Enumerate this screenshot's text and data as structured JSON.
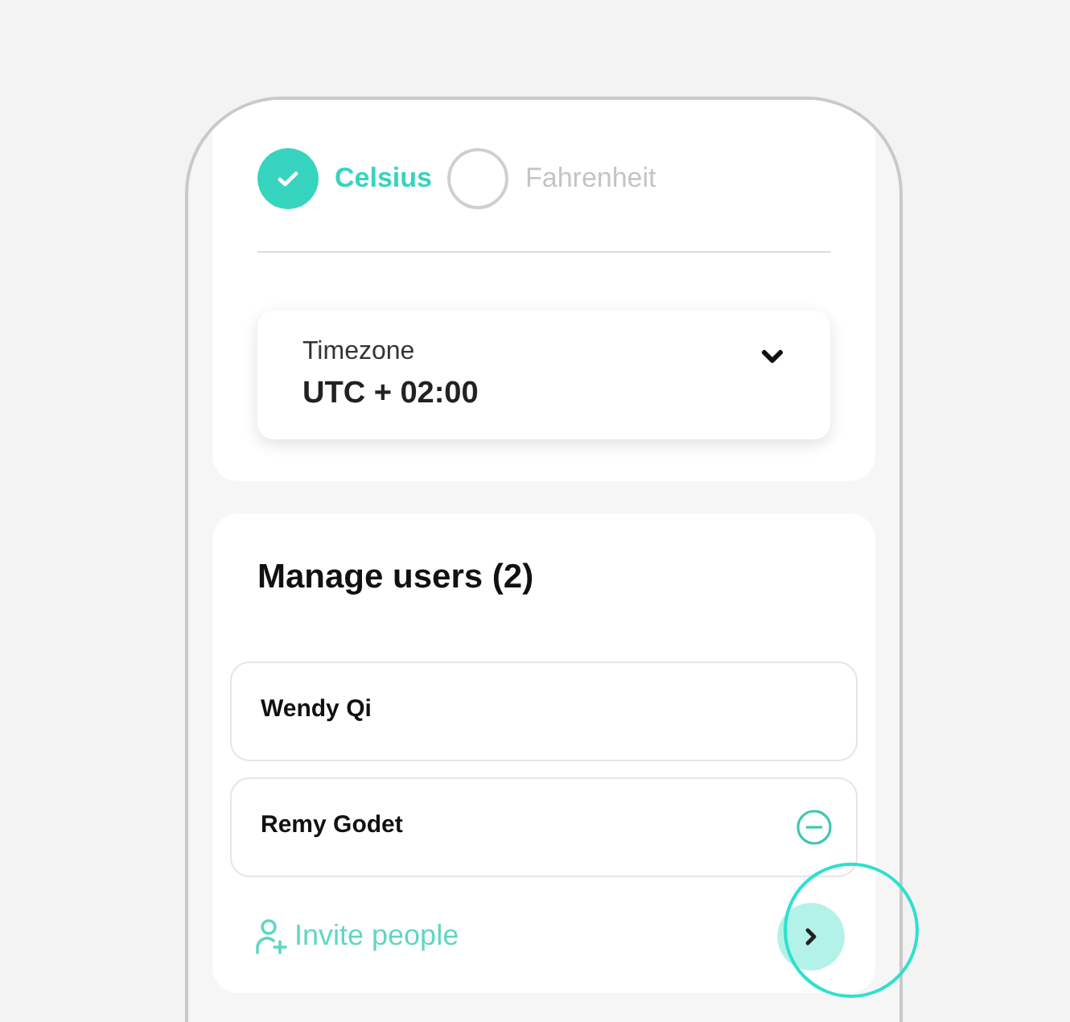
{
  "units": [
    {
      "label": "Celsius",
      "selected": true
    },
    {
      "label": "Fahrenheit",
      "selected": false
    }
  ],
  "timezone": {
    "label": "Timezone",
    "value": "UTC + 02:00"
  },
  "manage_users": {
    "title": "Manage users (2)",
    "users": [
      {
        "name": "Wendy Qi",
        "removable": false
      },
      {
        "name": "Remy Godet",
        "removable": true
      }
    ],
    "invite": "Invite people"
  }
}
